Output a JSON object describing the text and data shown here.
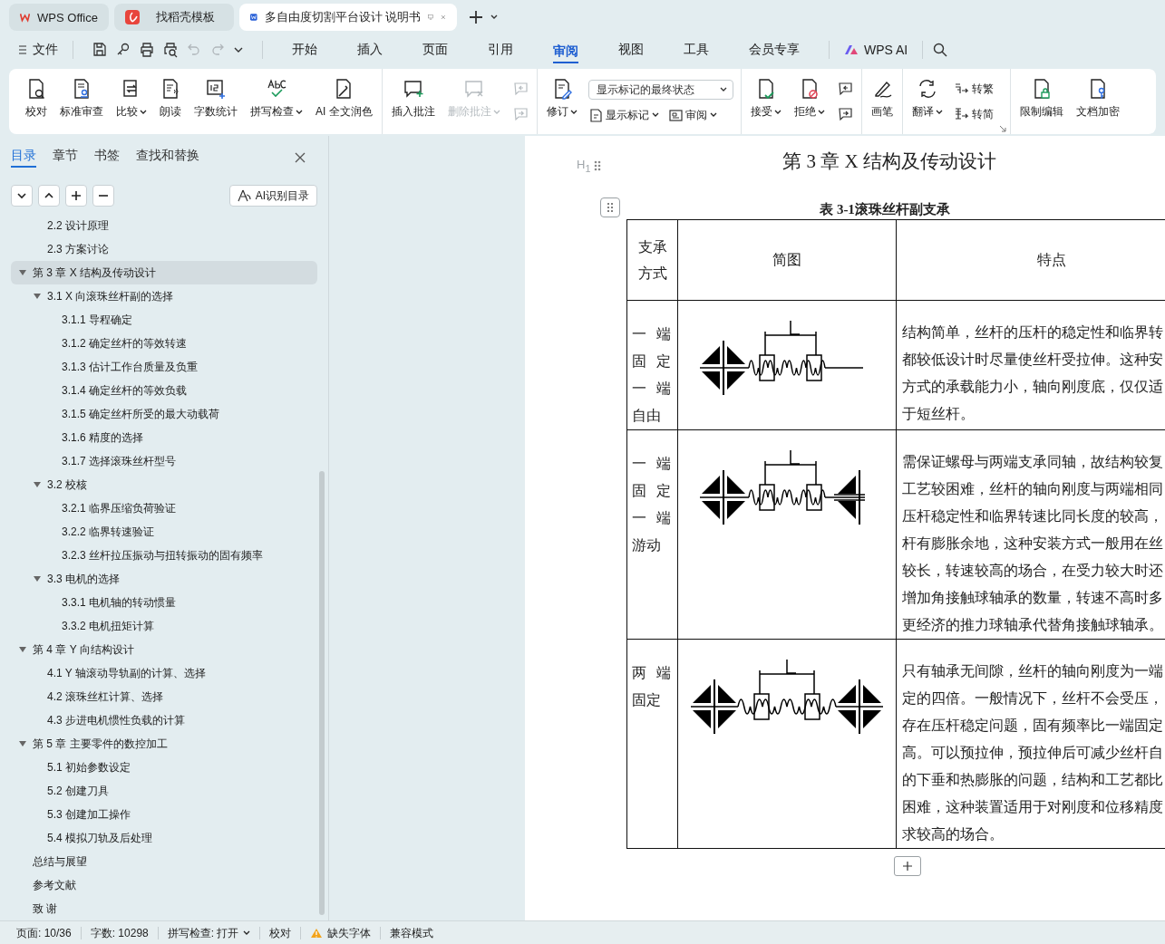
{
  "tabs": [
    {
      "label": "WPS Office",
      "selected": false
    },
    {
      "label": "找稻壳模板",
      "selected": false
    },
    {
      "label": "多自由度切割平台设计 说明书",
      "selected": true
    }
  ],
  "menu": {
    "file": "文件",
    "quick_access": [
      {
        "disabled": false
      },
      {
        "disabled": false
      },
      {
        "disabled": false
      },
      {
        "disabled": false
      },
      {
        "disabled": true
      },
      {
        "disabled": true
      }
    ],
    "tabs": [
      {
        "label": "开始",
        "selected": false
      },
      {
        "label": "插入",
        "selected": false
      },
      {
        "label": "页面",
        "selected": false
      },
      {
        "label": "引用",
        "selected": false
      },
      {
        "label": "审阅",
        "selected": true
      },
      {
        "label": "视图",
        "selected": false
      },
      {
        "label": "工具",
        "selected": false
      },
      {
        "label": "会员专享",
        "selected": false
      }
    ],
    "ai": "WPS AI"
  },
  "ribbon": {
    "groups": [
      {
        "items": [
          {
            "kind": "large",
            "label": "校对",
            "caret": false,
            "disabled": false
          },
          {
            "kind": "large",
            "label": "标准审查",
            "caret": false,
            "disabled": false
          },
          {
            "kind": "large",
            "label": "比较",
            "caret": true,
            "disabled": false
          },
          {
            "kind": "large",
            "label": "朗读",
            "caret": false,
            "disabled": false
          },
          {
            "kind": "large",
            "label": "字数统计",
            "caret": false,
            "disabled": false
          },
          {
            "kind": "large",
            "label": "拼写检查",
            "caret": true,
            "disabled": false
          },
          {
            "kind": "large",
            "label": "AI 全文润色",
            "caret": false,
            "disabled": false
          }
        ]
      },
      {
        "items": [
          {
            "kind": "large",
            "label": "插入批注",
            "caret": false,
            "disabled": false
          },
          {
            "kind": "large",
            "label": "删除批注",
            "caret": true,
            "disabled": true
          },
          {
            "kind": "icon-stack",
            "items": [
              {
                "disabled": true
              },
              {
                "disabled": true
              }
            ]
          }
        ]
      },
      {
        "items": [
          {
            "kind": "large",
            "label": "修订",
            "caret": true,
            "disabled": false
          },
          {
            "kind": "panel",
            "dropdown": "显示标记的最终状态",
            "items": [
              {
                "label": "显示标记",
                "caret": true
              },
              {
                "label": "审阅",
                "caret": true
              }
            ]
          }
        ]
      },
      {
        "items": [
          {
            "kind": "large",
            "label": "接受",
            "caret": true,
            "disabled": false
          },
          {
            "kind": "large",
            "label": "拒绝",
            "caret": true,
            "disabled": false
          },
          {
            "kind": "icon-stack",
            "items": [
              {
                "disabled": false
              },
              {
                "disabled": false
              }
            ]
          }
        ]
      },
      {
        "items": [
          {
            "kind": "large",
            "label": "画笔",
            "caret": false,
            "disabled": false
          }
        ]
      },
      {
        "items": [
          {
            "kind": "large",
            "label": "翻译",
            "caret": true,
            "disabled": false
          },
          {
            "kind": "small-stack",
            "items": [
              {
                "label": "转繁"
              },
              {
                "label": "转简"
              }
            ]
          }
        ]
      },
      {
        "items": [
          {
            "kind": "large",
            "label": "限制编辑",
            "caret": false,
            "disabled": false
          },
          {
            "kind": "large",
            "label": "文档加密",
            "caret": false,
            "disabled": false
          }
        ]
      }
    ]
  },
  "sidebar": {
    "tabs": [
      {
        "label": "目录",
        "selected": true
      },
      {
        "label": "章节",
        "selected": false
      },
      {
        "label": "书签",
        "selected": false
      },
      {
        "label": "查找和替换",
        "selected": false
      }
    ],
    "ai_button": "AI识别目录",
    "toc": [
      {
        "children": [
          {
            "label": "2.2 设计原理",
            "selected": false
          },
          {
            "label": "2.3 方案讨论",
            "selected": false
          }
        ]
      },
      {
        "label": "第 3 章  X 结构及传动设计",
        "selected": true,
        "expanded": true,
        "children": [
          {
            "label": "3.1 X 向滚珠丝杆副的选择",
            "selected": false,
            "expanded": true,
            "children": [
              {
                "label": "3.1.1 导程确定",
                "selected": false
              },
              {
                "label": "3.1.2 确定丝杆的等效转速",
                "selected": false
              },
              {
                "label": "3.1.3 估计工作台质量及负重",
                "selected": false
              },
              {
                "label": "3.1.4 确定丝杆的等效负载",
                "selected": false
              },
              {
                "label": "3.1.5 确定丝杆所受的最大动载荷",
                "selected": false
              },
              {
                "label": "3.1.6 精度的选择",
                "selected": false
              },
              {
                "label": "3.1.7 选择滚珠丝杆型号",
                "selected": false
              }
            ]
          },
          {
            "label": "3.2 校核",
            "selected": false,
            "expanded": true,
            "children": [
              {
                "label": "3.2.1  临界压缩负荷验证",
                "selected": false
              },
              {
                "label": "3.2.2 临界转速验证",
                "selected": false
              },
              {
                "label": "3.2.3 丝杆拉压振动与扭转振动的固有频率",
                "selected": false
              }
            ]
          },
          {
            "label": "3.3 电机的选择",
            "selected": false,
            "expanded": true,
            "children": [
              {
                "label": "3.3.1 电机轴的转动惯量",
                "selected": false
              },
              {
                "label": "3.3.2 电机扭矩计算",
                "selected": false
              }
            ]
          }
        ]
      },
      {
        "label": "第 4 章  Y 向结构设计",
        "selected": false,
        "expanded": true,
        "children": [
          {
            "label": "4.1 Y 轴滚动导轨副的计算、选择",
            "selected": false
          },
          {
            "label": "4.2  滚珠丝杠计算、选择",
            "selected": false
          },
          {
            "label": "4.3  步进电机惯性负载的计算",
            "selected": false
          }
        ]
      },
      {
        "label": "第 5 章  主要零件的数控加工",
        "selected": false,
        "expanded": true,
        "children": [
          {
            "label": "5.1  初始参数设定",
            "selected": false
          },
          {
            "label": "5.2  创建刀具",
            "selected": false
          },
          {
            "label": "5.3  创建加工操作",
            "selected": false
          },
          {
            "label": "5.4  模拟刀轨及后处理",
            "selected": false
          }
        ]
      },
      {
        "label": "总结与展望",
        "selected": false
      },
      {
        "label": "参考文献",
        "selected": false
      },
      {
        "label": "致  谢",
        "selected": false
      }
    ]
  },
  "document": {
    "heading_marker": "H$_{1}$",
    "heading": "第 3 章  X 结构及传动设计",
    "caption": "表 3-1滚珠丝杆副支承",
    "table": {
      "columns": [
        "支承方式",
        "简图",
        "特点"
      ],
      "rows": [
        {
          "kind": "fixed-free",
          "mode": [
            "一 端",
            "固 定",
            "一 端",
            "自由"
          ],
          "features": [
            "结构简单，丝杆的压杆的稳定性和临界转",
            "都较低设计时尽量使丝杆受拉伸。这种安",
            "方式的承载能力小，轴向刚度底，仅仅适",
            "于短丝杆。"
          ]
        },
        {
          "kind": "fixed-floating",
          "mode": [
            "一 端",
            "固 定",
            "一 端",
            "游动"
          ],
          "features": [
            "需保证螺母与两端支承同轴，故结构较复",
            "工艺较困难，丝杆的轴向刚度与两端相同",
            "压杆稳定性和临界转速比同长度的较高，",
            "杆有膨胀余地，这种安装方式一般用在丝",
            "较长，转速较高的场合，在受力较大时还",
            "增加角接触球轴承的数量，转速不高时多",
            "更经济的推力球轴承代替角接触球轴承。"
          ]
        },
        {
          "kind": "fixed-fixed",
          "mode": [
            "两 端",
            "固定"
          ],
          "features": [
            "只有轴承无间隙，丝杆的轴向刚度为一端",
            "定的四倍。一般情况下，丝杆不会受压，",
            "存在压杆稳定问题，固有频率比一端固定",
            "高。可以预拉伸，预拉伸后可减少丝杆自",
            "的下垂和热膨胀的问题，结构和工艺都比",
            "困难，这种装置适用于对刚度和位移精度",
            "求较高的场合。"
          ]
        }
      ]
    }
  },
  "status_bar": [
    {
      "kind": "text",
      "label": "页面: 10/36"
    },
    {
      "kind": "text",
      "label": "字数: 10298"
    },
    {
      "kind": "dropdown",
      "label": "拼写检查: 打开"
    },
    {
      "kind": "text",
      "label": "校对"
    },
    {
      "kind": "warning",
      "label": "缺失字体"
    },
    {
      "kind": "text",
      "label": "兼容模式"
    }
  ]
}
